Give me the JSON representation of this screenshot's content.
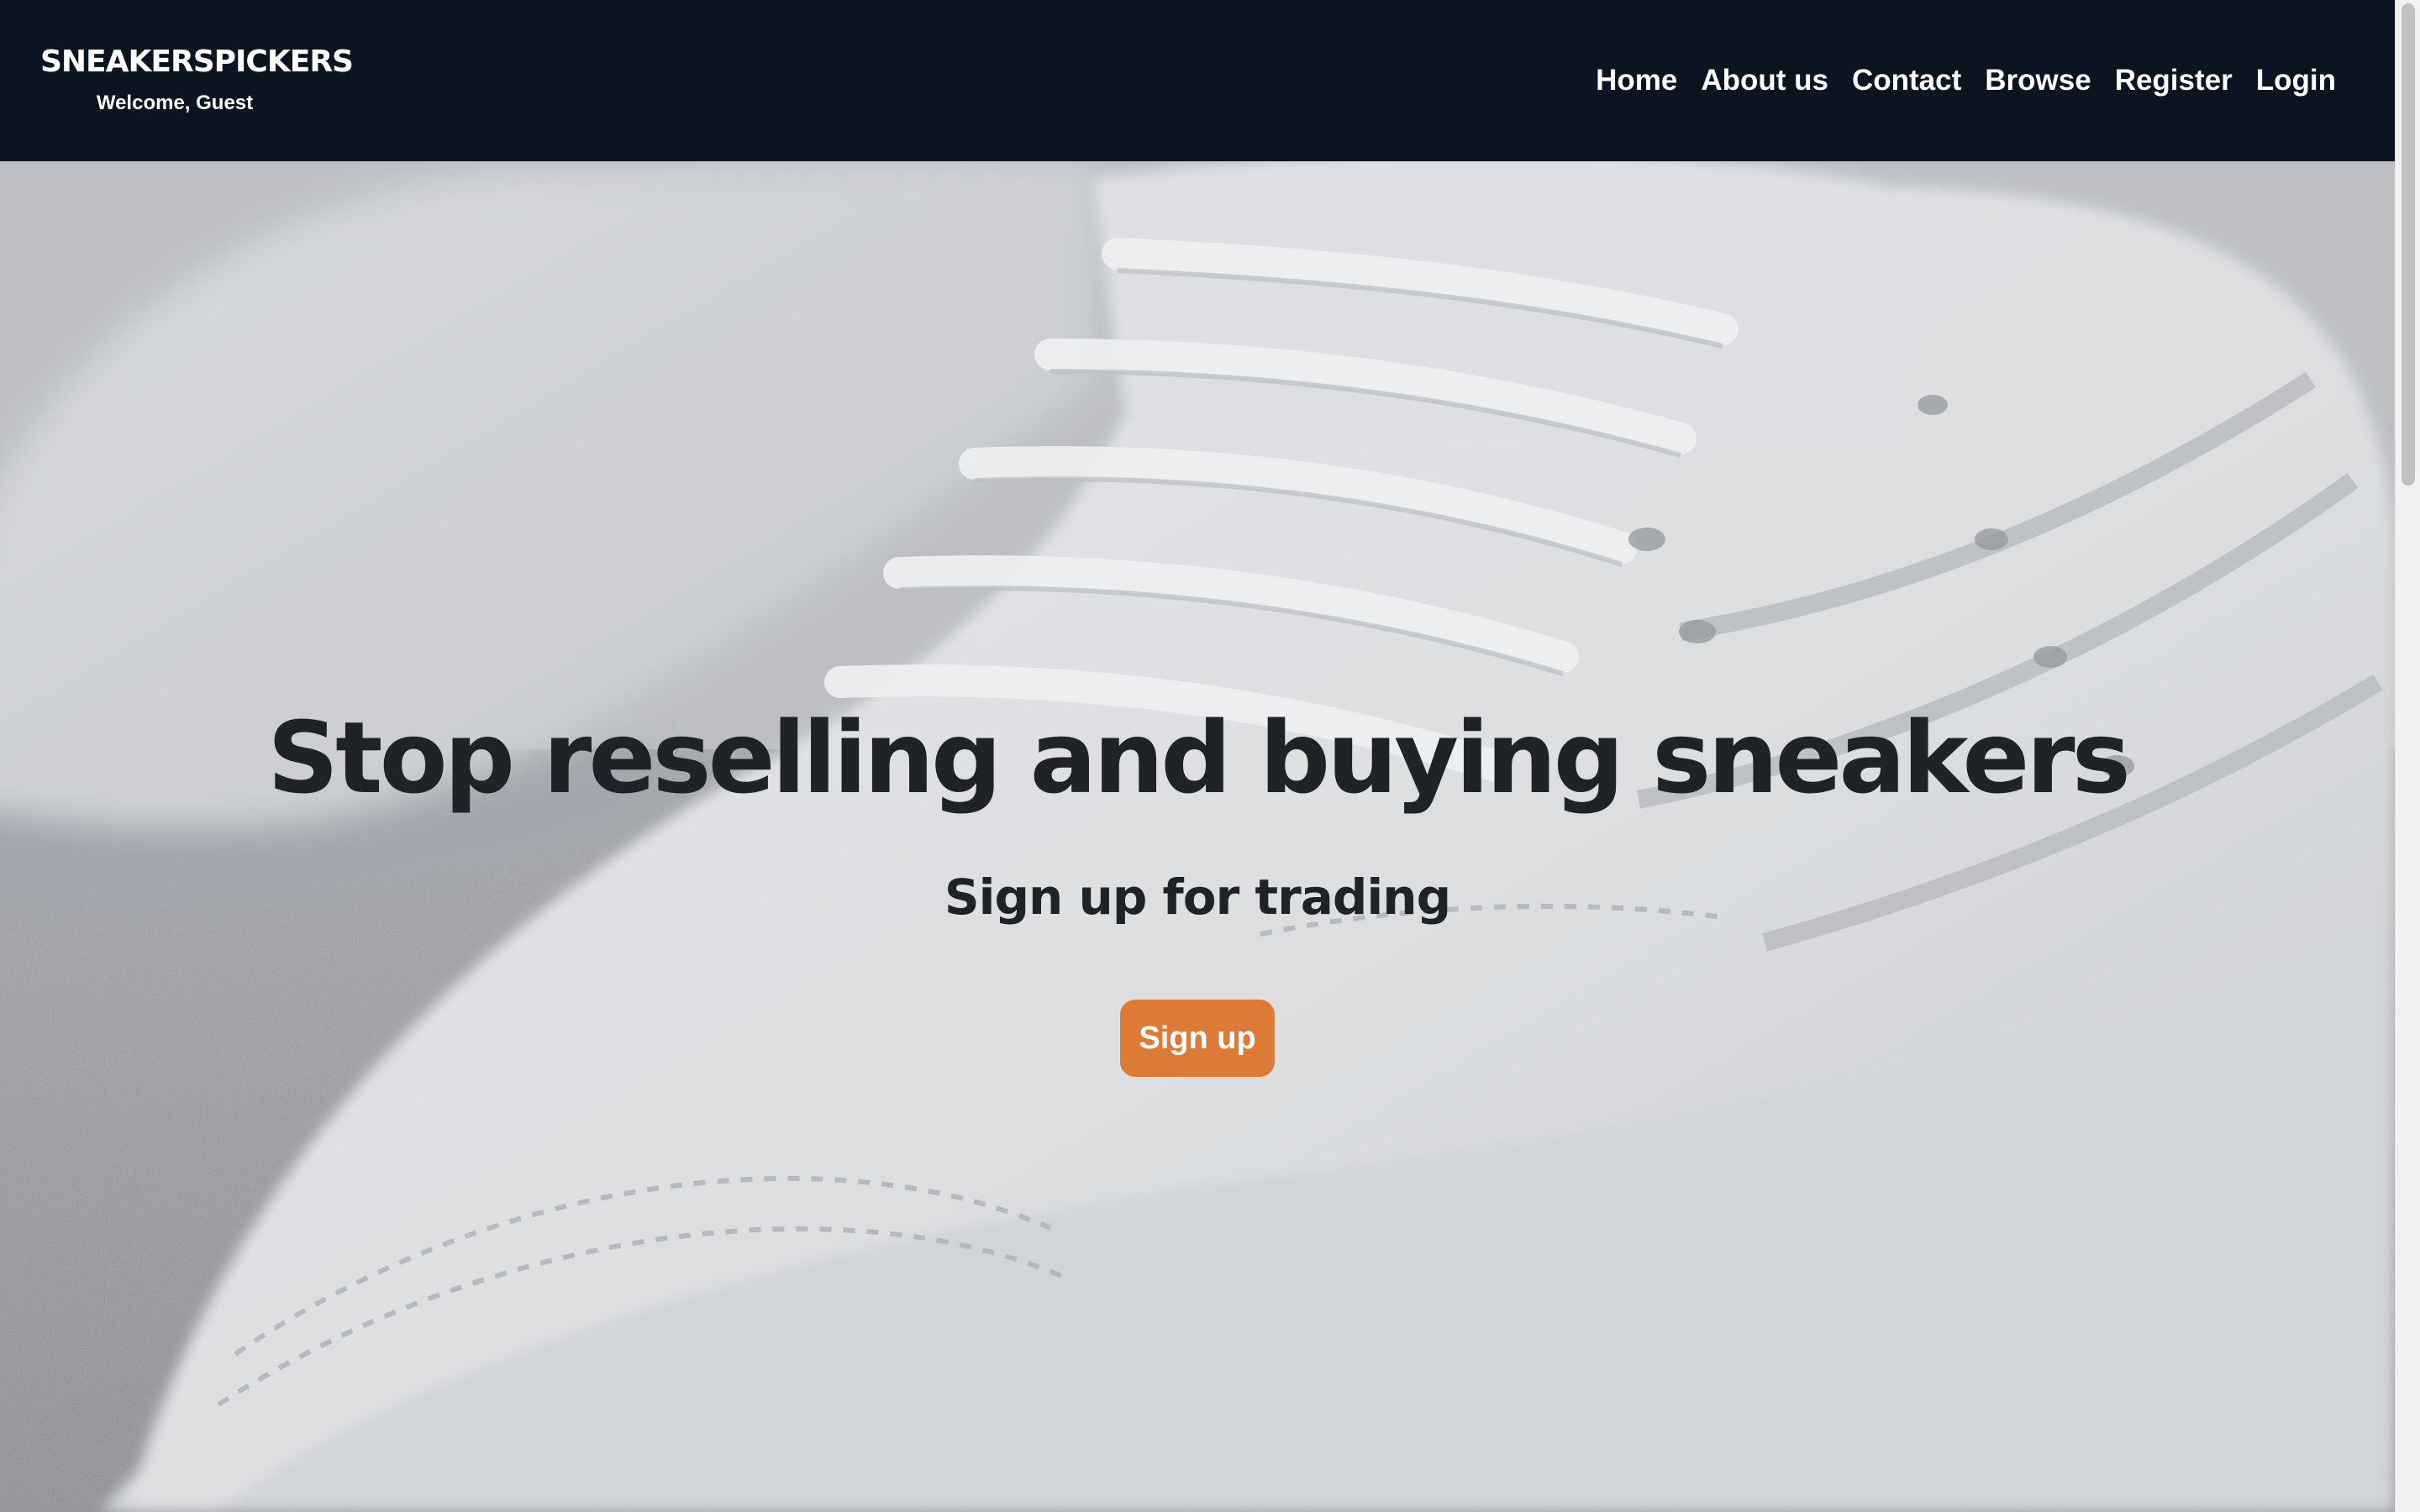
{
  "navbar": {
    "brand": "SNEAKERSPICKERS",
    "welcome": "Welcome, Guest",
    "links": [
      "Home",
      "About us",
      "Contact",
      "Browse",
      "Register",
      "Login"
    ]
  },
  "hero": {
    "title": "Stop reselling and buying sneakers",
    "subtitle": "Sign up for trading",
    "button_label": "Sign up",
    "background_image": "sneaker-photo"
  },
  "colors": {
    "navbar_bg": "#0b1521",
    "accent": "#dd7a35",
    "hero_text": "#1f2227"
  }
}
